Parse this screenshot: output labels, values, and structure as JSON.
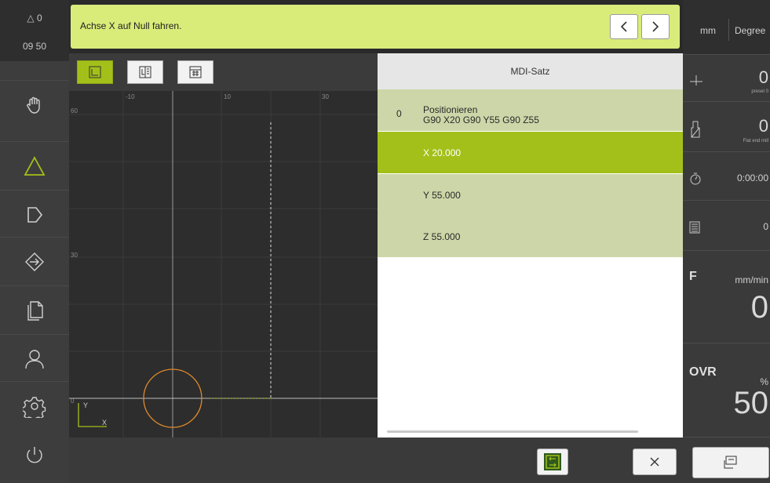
{
  "status": {
    "indicator": "△ 0",
    "time": "09 50"
  },
  "sidebar": {
    "items": [
      {
        "icon": "hand-icon"
      },
      {
        "icon": "triangle-icon",
        "active": true
      },
      {
        "icon": "arrow-icon"
      },
      {
        "icon": "enter-icon"
      },
      {
        "icon": "files-icon"
      },
      {
        "icon": "user-icon"
      },
      {
        "icon": "gear-icon"
      },
      {
        "icon": "power-icon"
      }
    ]
  },
  "message": {
    "text": "Achse X auf Null fahren."
  },
  "graph": {
    "x_ticks": [
      "-10",
      "10",
      "30"
    ],
    "y_ticks": [
      "60",
      "30",
      "0"
    ],
    "axis_y": "Y",
    "axis_x": "X"
  },
  "mdi": {
    "title": "MDI-Satz",
    "block_number": "0",
    "block_title": "Positionieren",
    "block_cmd": "G90 X20 G90 Y55 G90 Z55",
    "rows": [
      "X 20.000",
      "Y 55.000",
      "Z 55.000"
    ]
  },
  "right": {
    "unit_mm": "mm",
    "unit_deg": "Degree",
    "preset_value": "0",
    "preset_label": "preset 0",
    "tool_value": "0",
    "tool_label": "Flat end mill",
    "time_value": "0:00:00",
    "count_value": "0",
    "feed_label": "F",
    "feed_unit": "mm/min",
    "feed_value": "0",
    "ovr_label": "OVR",
    "ovr_unit": "%",
    "ovr_value": "50"
  },
  "colors": {
    "accent": "#a3c01a",
    "message_bg": "#d9ec7a",
    "mdi_row": "#cdd6a8"
  }
}
